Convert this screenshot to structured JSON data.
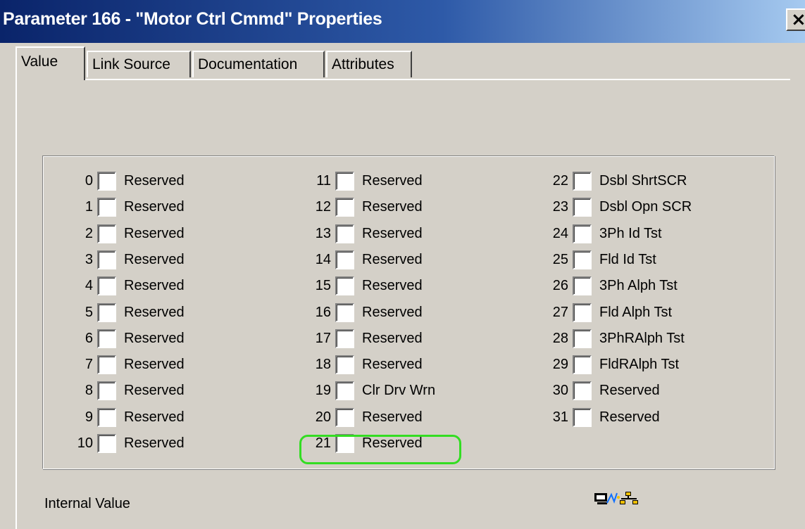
{
  "window": {
    "title": "Parameter 166 - \"Motor Ctrl Cmmd\" Properties",
    "close_glyph": "×"
  },
  "tabs": [
    {
      "label": "Value",
      "active": true
    },
    {
      "label": "Link Source",
      "active": false
    },
    {
      "label": "Documentation",
      "active": false
    },
    {
      "label": "Attributes",
      "active": false
    }
  ],
  "bits": [
    {
      "num": "0",
      "label": "Reserved",
      "checked": false
    },
    {
      "num": "1",
      "label": "Reserved",
      "checked": false
    },
    {
      "num": "2",
      "label": "Reserved",
      "checked": false
    },
    {
      "num": "3",
      "label": "Reserved",
      "checked": false
    },
    {
      "num": "4",
      "label": "Reserved",
      "checked": false
    },
    {
      "num": "5",
      "label": "Reserved",
      "checked": false
    },
    {
      "num": "6",
      "label": "Reserved",
      "checked": false
    },
    {
      "num": "7",
      "label": "Reserved",
      "checked": false
    },
    {
      "num": "8",
      "label": "Reserved",
      "checked": false
    },
    {
      "num": "9",
      "label": "Reserved",
      "checked": false
    },
    {
      "num": "10",
      "label": "Reserved",
      "checked": false
    },
    {
      "num": "11",
      "label": "Reserved",
      "checked": false
    },
    {
      "num": "12",
      "label": "Reserved",
      "checked": false
    },
    {
      "num": "13",
      "label": "Reserved",
      "checked": false
    },
    {
      "num": "14",
      "label": "Reserved",
      "checked": false
    },
    {
      "num": "15",
      "label": "Reserved",
      "checked": false
    },
    {
      "num": "16",
      "label": "Reserved",
      "checked": false
    },
    {
      "num": "17",
      "label": "Reserved",
      "checked": false
    },
    {
      "num": "18",
      "label": "Reserved",
      "checked": false
    },
    {
      "num": "19",
      "label": "Clr Drv Wrn",
      "checked": false
    },
    {
      "num": "20",
      "label": "Reserved",
      "checked": false
    },
    {
      "num": "21",
      "label": "Reserved",
      "checked": false
    },
    {
      "num": "22",
      "label": "Dsbl ShrtSCR",
      "checked": false
    },
    {
      "num": "23",
      "label": "Dsbl Opn SCR",
      "checked": false
    },
    {
      "num": "24",
      "label": "3Ph Id Tst",
      "checked": false
    },
    {
      "num": "25",
      "label": "Fld Id Tst",
      "checked": false
    },
    {
      "num": "26",
      "label": "3Ph Alph Tst",
      "checked": false
    },
    {
      "num": "27",
      "label": "Fld Alph Tst",
      "checked": false
    },
    {
      "num": "28",
      "label": "3PhRAlph Tst",
      "checked": false
    },
    {
      "num": "29",
      "label": "FldRAlph Tst",
      "checked": false
    },
    {
      "num": "30",
      "label": "Reserved",
      "checked": false
    },
    {
      "num": "31",
      "label": "Reserved",
      "checked": false
    }
  ],
  "footer": {
    "internal_value_label": "Internal Value",
    "status_icon": "network-online-icon"
  },
  "colors": {
    "titlebar_start": "#0a246a",
    "titlebar_end": "#a6caf0",
    "dialog_face": "#d4d0c8",
    "highlight": "#33dd22"
  }
}
